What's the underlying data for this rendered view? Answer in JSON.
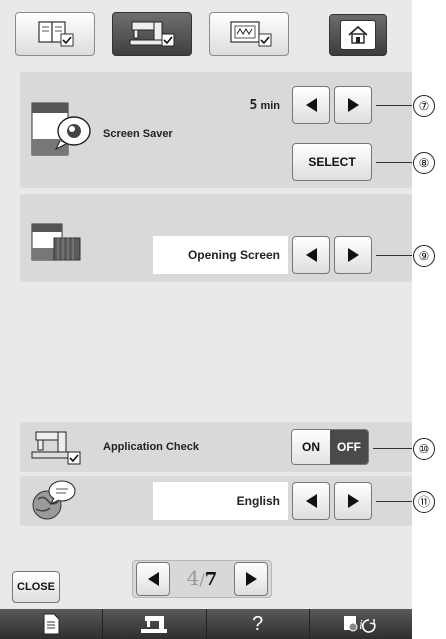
{
  "tabs": [
    {
      "icon": "settings-page-book-icon",
      "active": false
    },
    {
      "icon": "sewing-machine-settings-icon",
      "active": true
    },
    {
      "icon": "embroidery-settings-icon",
      "active": false
    }
  ],
  "home": {
    "icon": "home-icon"
  },
  "screen_saver": {
    "label": "Screen Saver",
    "time_value": "5",
    "time_unit": "min",
    "select_label": "SELECT",
    "callout_time": "⑦",
    "callout_select": "⑧"
  },
  "opening_screen": {
    "value": "Opening Screen",
    "callout": "⑨"
  },
  "application_check": {
    "label": "Application Check",
    "on_label": "ON",
    "off_label": "OFF",
    "state": "OFF",
    "callout": "⑩"
  },
  "language": {
    "value": "English",
    "callout": "⑪"
  },
  "pager": {
    "current": "4",
    "total": "7"
  },
  "close_label": "CLOSE",
  "bottom_bar": {
    "help_label": "?"
  },
  "colors": {
    "panel": "#d9d9d9",
    "active_tab": "#4a4a4a",
    "toggle_off": "#4a4a4a"
  }
}
